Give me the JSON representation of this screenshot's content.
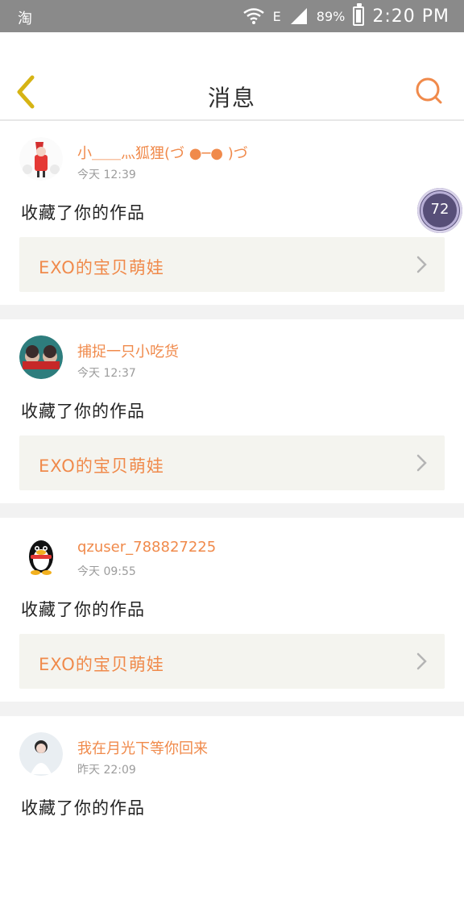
{
  "status_bar": {
    "left_icon": "淘",
    "network": "E",
    "battery": "89%",
    "time": "2:20 PM"
  },
  "header": {
    "title": "消息",
    "back_icon": "chevron-left-icon",
    "search_icon": "search-icon",
    "accent": "#f08a4b"
  },
  "messages": [
    {
      "user": "小＿＿灬狐狸(づ ●─● )づ",
      "time": "今天  12:39",
      "action": "收藏了你的作品",
      "work": "EXO的宝贝萌娃"
    },
    {
      "user": "捕捉一只小吃货",
      "time": "今天  12:37",
      "action": "收藏了你的作品",
      "work": "EXO的宝贝萌娃"
    },
    {
      "user": "qzuser_788827225",
      "time": "今天  09:55",
      "action": "收藏了你的作品",
      "work": "EXO的宝贝萌娃"
    },
    {
      "user": "我在月光下等你回来",
      "time": "昨天  22:09",
      "action": "收藏了你的作品",
      "work": ""
    }
  ],
  "floating_badge": {
    "value": "72"
  }
}
